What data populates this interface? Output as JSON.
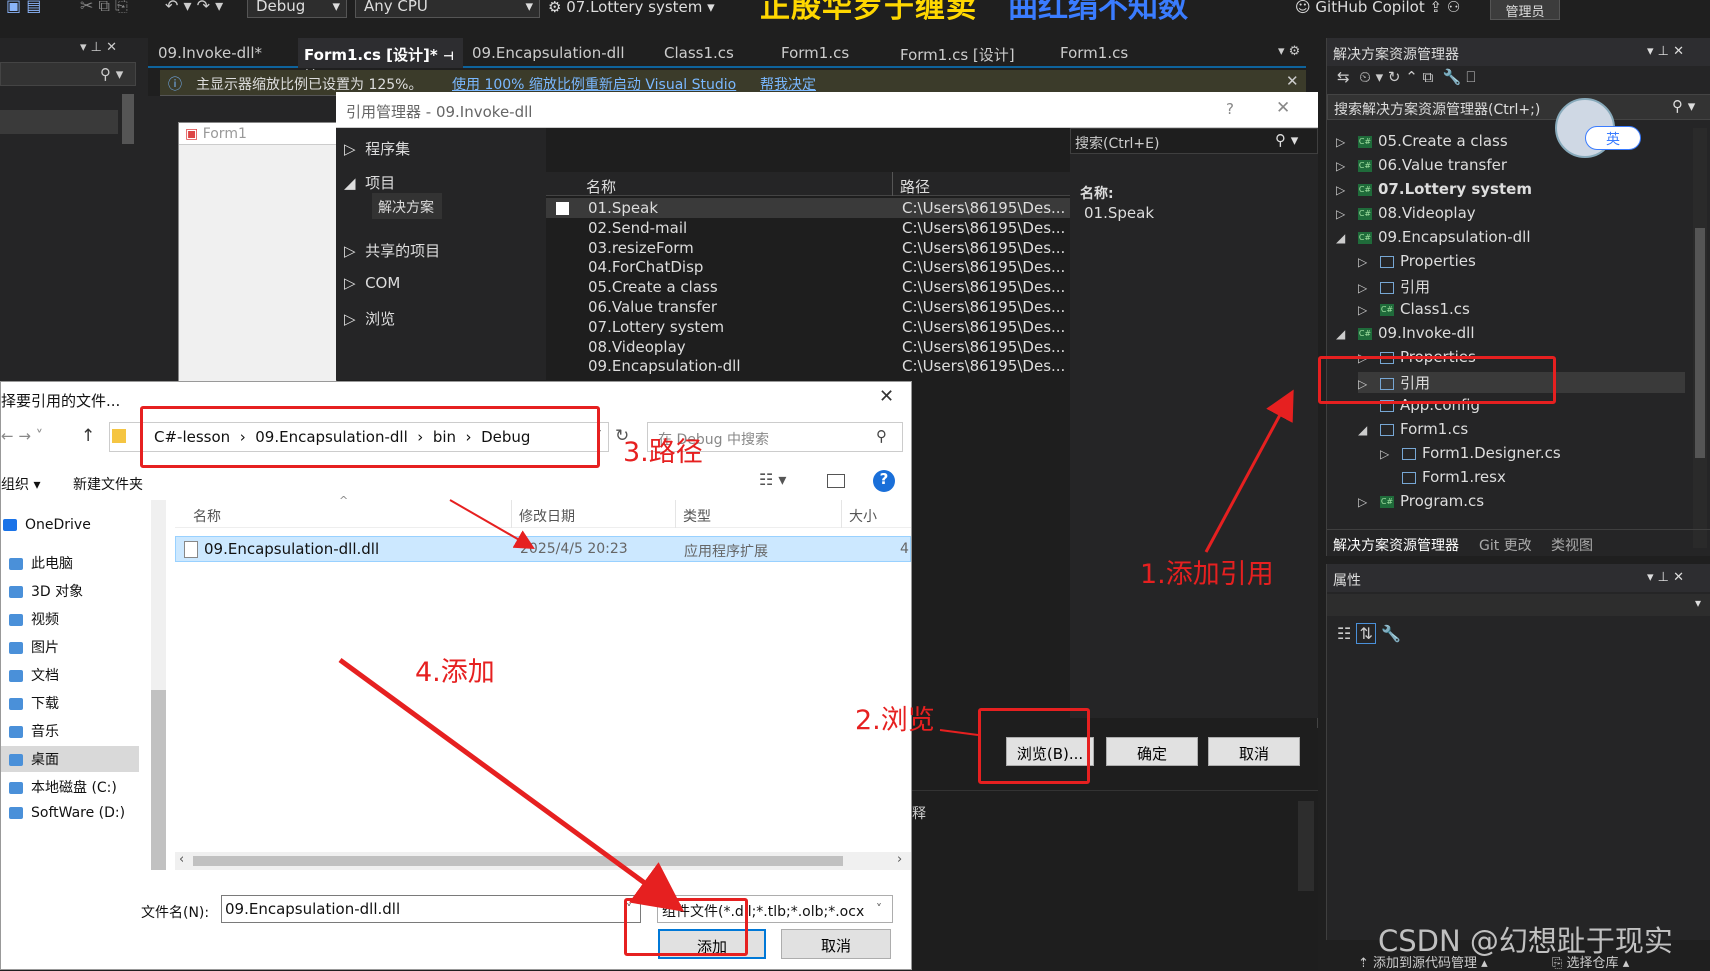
{
  "toolbar": {
    "config": "Debug",
    "platform": "Any CPU",
    "startup_project": "07.Lottery system",
    "banner_left": "正殷华罗于缠卖",
    "banner_right": "曲红绢不知数",
    "copilot": "GitHub Copilot",
    "admin": "管理员"
  },
  "doc_tabs": [
    "09.Invoke-dll*",
    "Form1.cs [设计]*",
    "09.Encapsulation-dll",
    "Class1.cs",
    "Form1.cs",
    "Form1.cs [设计]",
    "Form1.cs"
  ],
  "infobar": {
    "message": "主显示器缩放比例已设置为 125%。",
    "link1": "使用 100% 缩放比例重新启动 Visual Studio",
    "link2": "帮我决定"
  },
  "designer": {
    "form_title": "Form1"
  },
  "ref_manager": {
    "title": "引用管理器 - 09.Invoke-dll",
    "help": "?",
    "nav": {
      "assemblies": "程序集",
      "projects": "项目",
      "solution": "解决方案",
      "shared": "共享的项目",
      "com": "COM",
      "browse": "浏览"
    },
    "search_placeholder": "搜索(Ctrl+E)",
    "columns": {
      "name": "名称",
      "path": "路径"
    },
    "rows": [
      {
        "name": "01.Speak",
        "path": "C:\\Users\\86195\\Des..."
      },
      {
        "name": "02.Send-mail",
        "path": "C:\\Users\\86195\\Des..."
      },
      {
        "name": "03.resizeForm",
        "path": "C:\\Users\\86195\\Des..."
      },
      {
        "name": "04.ForChatDisp",
        "path": "C:\\Users\\86195\\Des..."
      },
      {
        "name": "05.Create a class",
        "path": "C:\\Users\\86195\\Des..."
      },
      {
        "name": "06.Value transfer",
        "path": "C:\\Users\\86195\\Des..."
      },
      {
        "name": "07.Lottery system",
        "path": "C:\\Users\\86195\\Des..."
      },
      {
        "name": "08.Videoplay",
        "path": "C:\\Users\\86195\\Des..."
      },
      {
        "name": "09.Encapsulation-dll",
        "path": "C:\\Users\\86195\\Des..."
      }
    ],
    "detail_label": "名称:",
    "detail_value": "01.Speak",
    "buttons": {
      "browse": "浏览(B)...",
      "ok": "确定",
      "cancel": "取消"
    },
    "comment_partial": "释"
  },
  "solution_explorer": {
    "title": "解决方案资源管理器",
    "search_placeholder": "搜索解决方案资源管理器(Ctrl+;)",
    "ime": "英",
    "items": [
      {
        "label": "05.Create a class",
        "bold": false
      },
      {
        "label": "06.Value transfer",
        "bold": false
      },
      {
        "label": "07.Lottery system",
        "bold": true
      },
      {
        "label": "08.Videoplay",
        "bold": false
      },
      {
        "label": "09.Encapsulation-dll",
        "bold": false
      },
      {
        "label": "Properties",
        "bold": false
      },
      {
        "label": "引用",
        "bold": false
      },
      {
        "label": "Class1.cs",
        "bold": false
      },
      {
        "label": "09.Invoke-dll",
        "bold": false
      },
      {
        "label": "Properties",
        "bold": false
      },
      {
        "label": "引用",
        "bold": false
      },
      {
        "label": "App.config",
        "bold": false
      },
      {
        "label": "Form1.cs",
        "bold": false
      },
      {
        "label": "Form1.Designer.cs",
        "bold": false
      },
      {
        "label": "Form1.resx",
        "bold": false
      },
      {
        "label": "Program.cs",
        "bold": false
      }
    ],
    "bottom_tabs": [
      "解决方案资源管理器",
      "Git 更改",
      "类视图"
    ]
  },
  "properties": {
    "title": "属性"
  },
  "file_dialog": {
    "title": "择要引用的文件...",
    "breadcrumb": [
      "C#-lesson",
      "09.Encapsulation-dll",
      "bin",
      "Debug"
    ],
    "search_placeholder": "在 Debug 中搜索",
    "organize": "组织",
    "new_folder": "新建文件夹",
    "columns": {
      "name": "名称",
      "modified": "修改日期",
      "type": "类型",
      "size": "大小"
    },
    "file": {
      "name": "09.Encapsulation-dll.dll",
      "modified": "2025/4/5 20:23",
      "type": "应用程序扩展",
      "size": "4"
    },
    "sidebar": [
      "OneDrive",
      "此电脑",
      "3D 对象",
      "视频",
      "图片",
      "文档",
      "下载",
      "音乐",
      "桌面",
      "本地磁盘 (C:)",
      "SoftWare (D:)"
    ],
    "filename_label": "文件名(N):",
    "filename_value": "09.Encapsulation-dll.dll",
    "filter": "组件文件(*.dll;*.tlb;*.olb;*.ocx",
    "add": "添加",
    "cancel": "取消"
  },
  "annotations": {
    "step1": "1.添加引用",
    "step2": "2.浏览",
    "step3": "3.路径",
    "step4": "4.添加",
    "color": "#e62020"
  },
  "statusbar": {
    "add_to_source": "添加到源代码管理",
    "select_repo": "选择仓库"
  },
  "watermark": "CSDN @幻想趾于现实"
}
